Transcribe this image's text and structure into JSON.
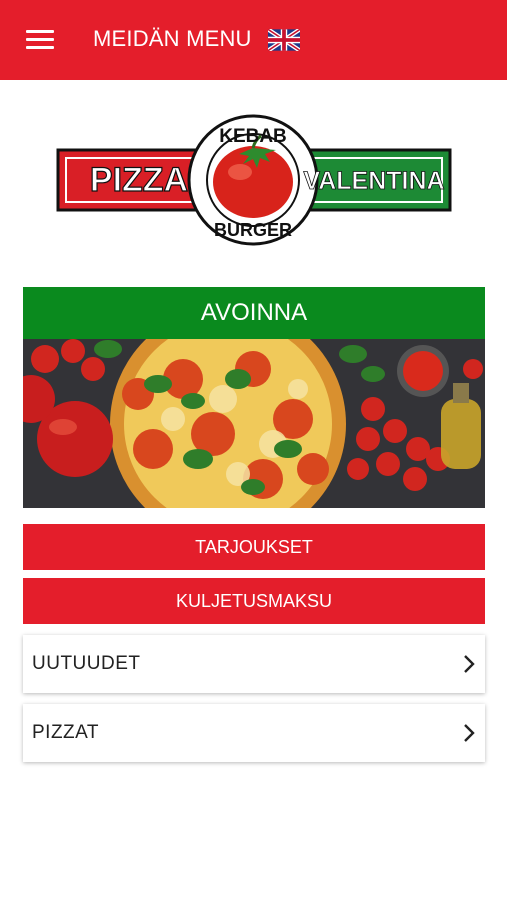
{
  "header": {
    "title": "MEIDÄN MENU",
    "language_icon": "uk-flag-icon",
    "menu_icon": "hamburger-menu-icon",
    "background": "#e41e2b"
  },
  "logo": {
    "top_text": "KEBAB",
    "left_text": "PIZZA",
    "right_text": "VALENTINA",
    "bottom_text": "BURGER"
  },
  "status": {
    "label": "AVOINNA",
    "color": "#0a8a1e"
  },
  "buttons": [
    {
      "label": "TARJOUKSET"
    },
    {
      "label": "KULJETUSMAKSU"
    }
  ],
  "categories": [
    {
      "label": "UUTUUDET",
      "icon": "chevron-right-icon"
    },
    {
      "label": "PIZZAT",
      "icon": "chevron-right-icon"
    }
  ]
}
